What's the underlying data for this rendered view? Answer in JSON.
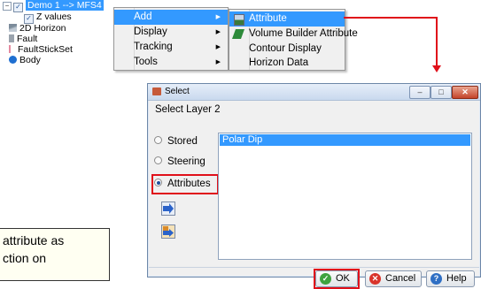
{
  "tree": {
    "items": [
      {
        "label": "Demo 1 --> MFS4",
        "selected": true
      },
      {
        "label": "Z values",
        "checked": true
      },
      {
        "label": "2D Horizon"
      },
      {
        "label": "Fault"
      },
      {
        "label": "FaultStickSet"
      },
      {
        "label": "Body"
      }
    ]
  },
  "context_menu": {
    "items": [
      "Add",
      "Display",
      "Tracking",
      "Tools"
    ],
    "highlighted": "Add"
  },
  "submenu": {
    "items": [
      "Attribute",
      "Volume Builder Attribute",
      "Contour Display",
      "Horizon Data"
    ],
    "highlighted": "Attribute"
  },
  "callout": {
    "lines": [
      "attribute as",
      "ction on"
    ]
  },
  "dialog": {
    "title": "Select",
    "subtitle": "Select Layer 2",
    "window_buttons": [
      "–",
      "□",
      "✕"
    ],
    "radios": [
      {
        "label": "Stored",
        "selected": false
      },
      {
        "label": "Steering",
        "selected": false
      },
      {
        "label": "Attributes",
        "selected": true
      }
    ],
    "list_items": [
      "Polar Dip"
    ],
    "buttons": {
      "ok": "OK",
      "cancel": "Cancel",
      "help": "Help"
    }
  },
  "colors": {
    "highlight": "#3399ff",
    "annotation_red": "#e0101a",
    "ok_icon": "#3fa33f",
    "cancel_icon": "#d9342b",
    "help_icon": "#2f6fc4"
  }
}
